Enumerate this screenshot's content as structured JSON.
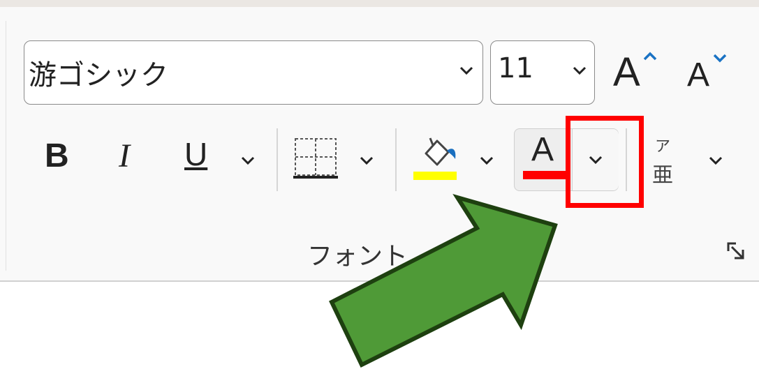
{
  "font_group": {
    "font_name": {
      "value": "游ゴシック"
    },
    "font_size": {
      "value": "11"
    },
    "grow_font": {
      "glyph": "A"
    },
    "shrink_font": {
      "glyph": "A"
    },
    "bold": {
      "glyph": "B"
    },
    "italic": {
      "glyph": "I"
    },
    "underline": {
      "glyph": "U"
    },
    "font_color": {
      "glyph": "A",
      "color": "#ff0000"
    },
    "fill_color": {
      "color": "#ffff00"
    },
    "phonetic_guide": {
      "top": "ア",
      "bottom": "亜"
    },
    "group_label": "フォント"
  },
  "annotations": {
    "highlight_color": "#ff0000",
    "arrow_fill": "#4f9a37",
    "arrow_stroke": "#1e4010"
  },
  "icons": [
    "chevron-down-icon",
    "borders-icon",
    "fill-bucket-icon",
    "dialog-launcher-icon"
  ]
}
